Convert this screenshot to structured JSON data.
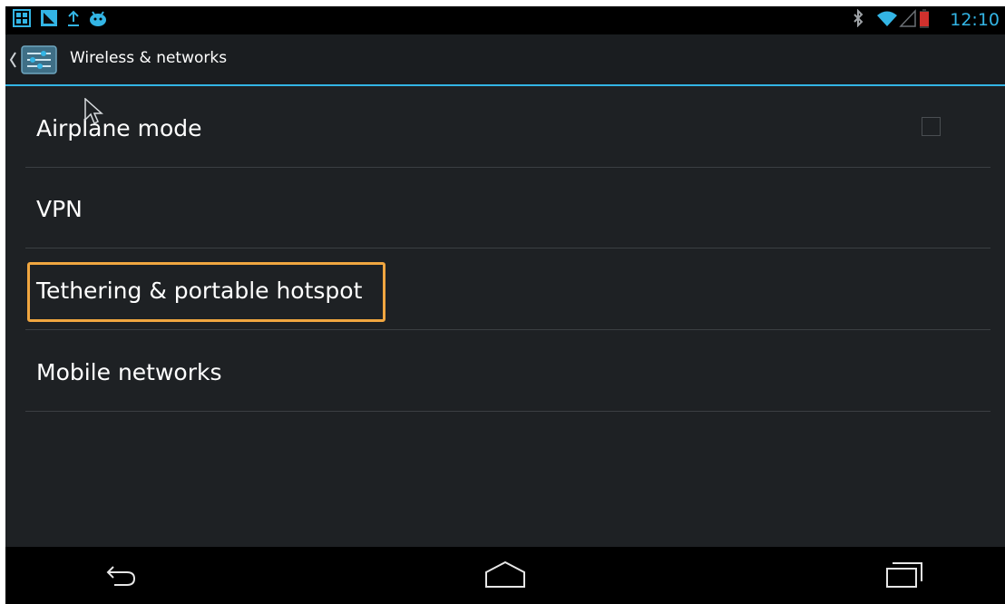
{
  "status_bar": {
    "left_icons": [
      "gallery-icon",
      "screenshot-icon",
      "upload-icon",
      "android-debug-icon"
    ],
    "right_icons": [
      "bluetooth-icon",
      "wifi-icon",
      "signal-icon",
      "battery-low-icon"
    ],
    "time": "12:10"
  },
  "action_bar": {
    "up_icon": "chevron-left-icon",
    "app_icon": "settings-sliders-icon",
    "title": "Wireless & networks"
  },
  "preferences": [
    {
      "title": "Airplane mode",
      "checkbox": true,
      "checked": false
    },
    {
      "title": "VPN"
    },
    {
      "title": "Tethering & portable hotspot",
      "highlighted": true
    },
    {
      "title": "Mobile networks"
    }
  ],
  "nav_bar": {
    "buttons": [
      "back-icon",
      "home-icon",
      "recent-apps-icon"
    ]
  },
  "colors": {
    "accent": "#33b5e5",
    "highlight": "#f0a640",
    "background": "#1e2124",
    "text": "#ffffff"
  }
}
